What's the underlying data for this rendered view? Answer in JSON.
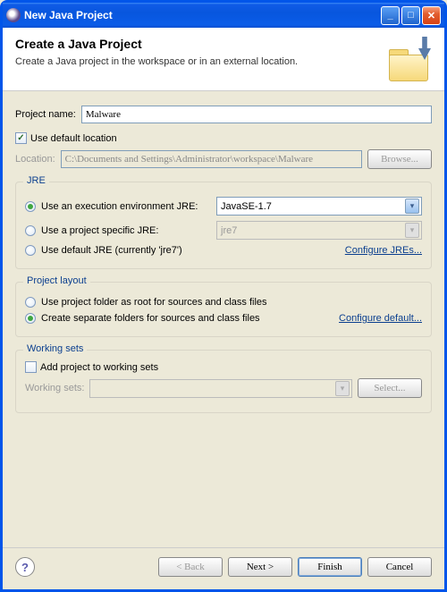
{
  "window": {
    "title": "New Java Project"
  },
  "header": {
    "title": "Create a Java Project",
    "subtitle": "Create a Java project in the workspace or in an external location."
  },
  "project": {
    "name_label": "Project name:",
    "name_value": "Malware"
  },
  "location": {
    "use_default_label": "Use default location",
    "use_default_checked": true,
    "label": "Location:",
    "value": "C:\\Documents and Settings\\Administrator\\workspace\\Malware",
    "browse": "Browse..."
  },
  "jre": {
    "group_title": "JRE",
    "exec_env_label": "Use an execution environment JRE:",
    "exec_env_value": "JavaSE-1.7",
    "project_specific_label": "Use a project specific JRE:",
    "project_specific_value": "jre7",
    "default_label": "Use default JRE (currently 'jre7')",
    "configure_link": "Configure JREs...",
    "selected": "exec_env"
  },
  "layout": {
    "group_title": "Project layout",
    "root_label": "Use project folder as root for sources and class files",
    "separate_label": "Create separate folders for sources and class files",
    "configure_link": "Configure default...",
    "selected": "separate"
  },
  "working_sets": {
    "group_title": "Working sets",
    "add_label": "Add project to working sets",
    "add_checked": false,
    "label": "Working sets:",
    "value": "",
    "select": "Select..."
  },
  "footer": {
    "back": "< Back",
    "next": "Next >",
    "finish": "Finish",
    "cancel": "Cancel"
  }
}
